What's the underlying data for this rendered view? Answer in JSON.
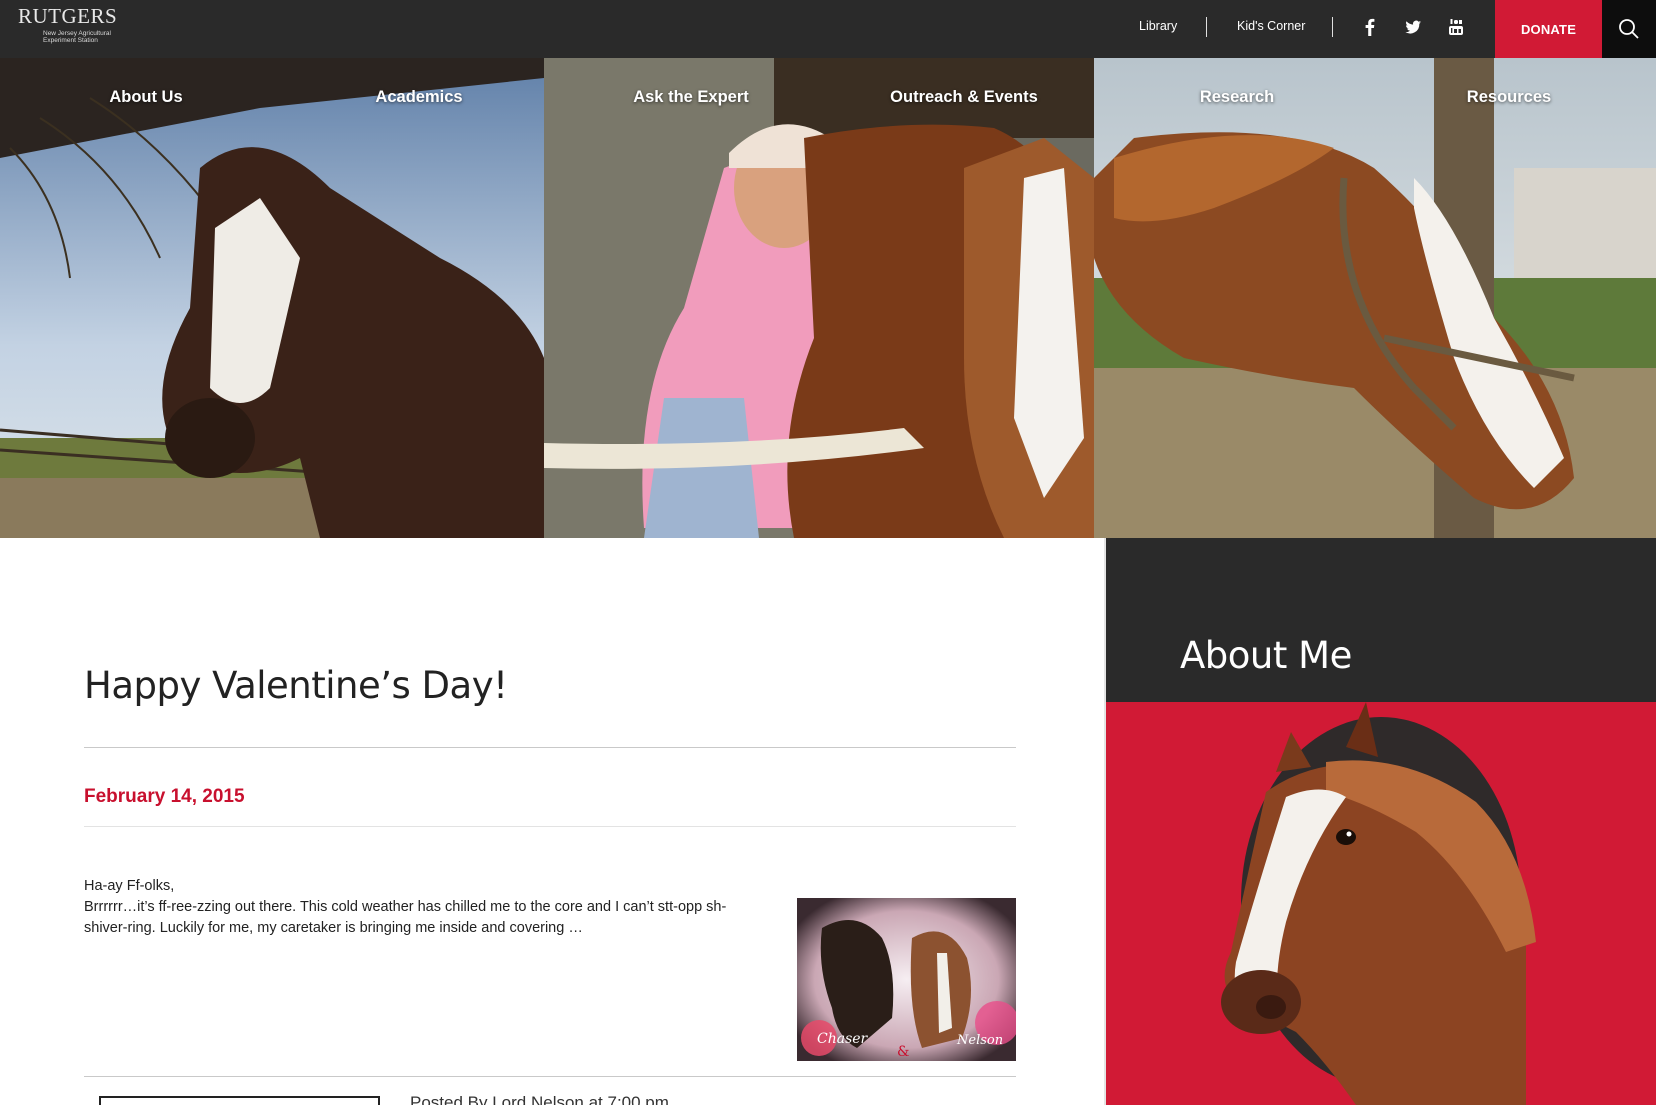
{
  "brand": {
    "name": "RUTGERS",
    "subtitle": "New Jersey Agricultural Experiment Station"
  },
  "topbar": {
    "links": [
      "Library",
      "Kid's Corner"
    ],
    "social_icons": [
      "facebook-icon",
      "twitter-icon",
      "youtube-icon"
    ],
    "donate_label": "DONATE",
    "search_icon": "search-icon",
    "colors": {
      "bar": "#2a2a2a",
      "donate": "#d11a35",
      "search": "#0d0d0d"
    }
  },
  "nav": {
    "items": [
      "About Us",
      "Academics",
      "Ask the Expert",
      "Outreach & Events",
      "Research",
      "Resources"
    ]
  },
  "post": {
    "title": "Happy Valentine’s Day!",
    "date": "February 14, 2015",
    "excerpt_line1": "Ha-ay Ff-olks,",
    "excerpt_line2": "Brrrrrr…it’s ff-ree-zzing out there.  This cold weather has chilled me to the core and I can’t stt-opp sh-shiver-ring. Luckily for me, my caretaker is bringing me inside and covering …",
    "thumbnail_caption_left": "Chaser",
    "thumbnail_caption_amp": "&",
    "thumbnail_caption_right": "Nelson",
    "posted_by": "Posted By Lord Nelson at 7:00 pm"
  },
  "sidebar": {
    "title": "About Me",
    "colors": {
      "header": "#2a2a2a",
      "panel": "#d11a35"
    }
  },
  "colors": {
    "accent": "#c8102e"
  }
}
